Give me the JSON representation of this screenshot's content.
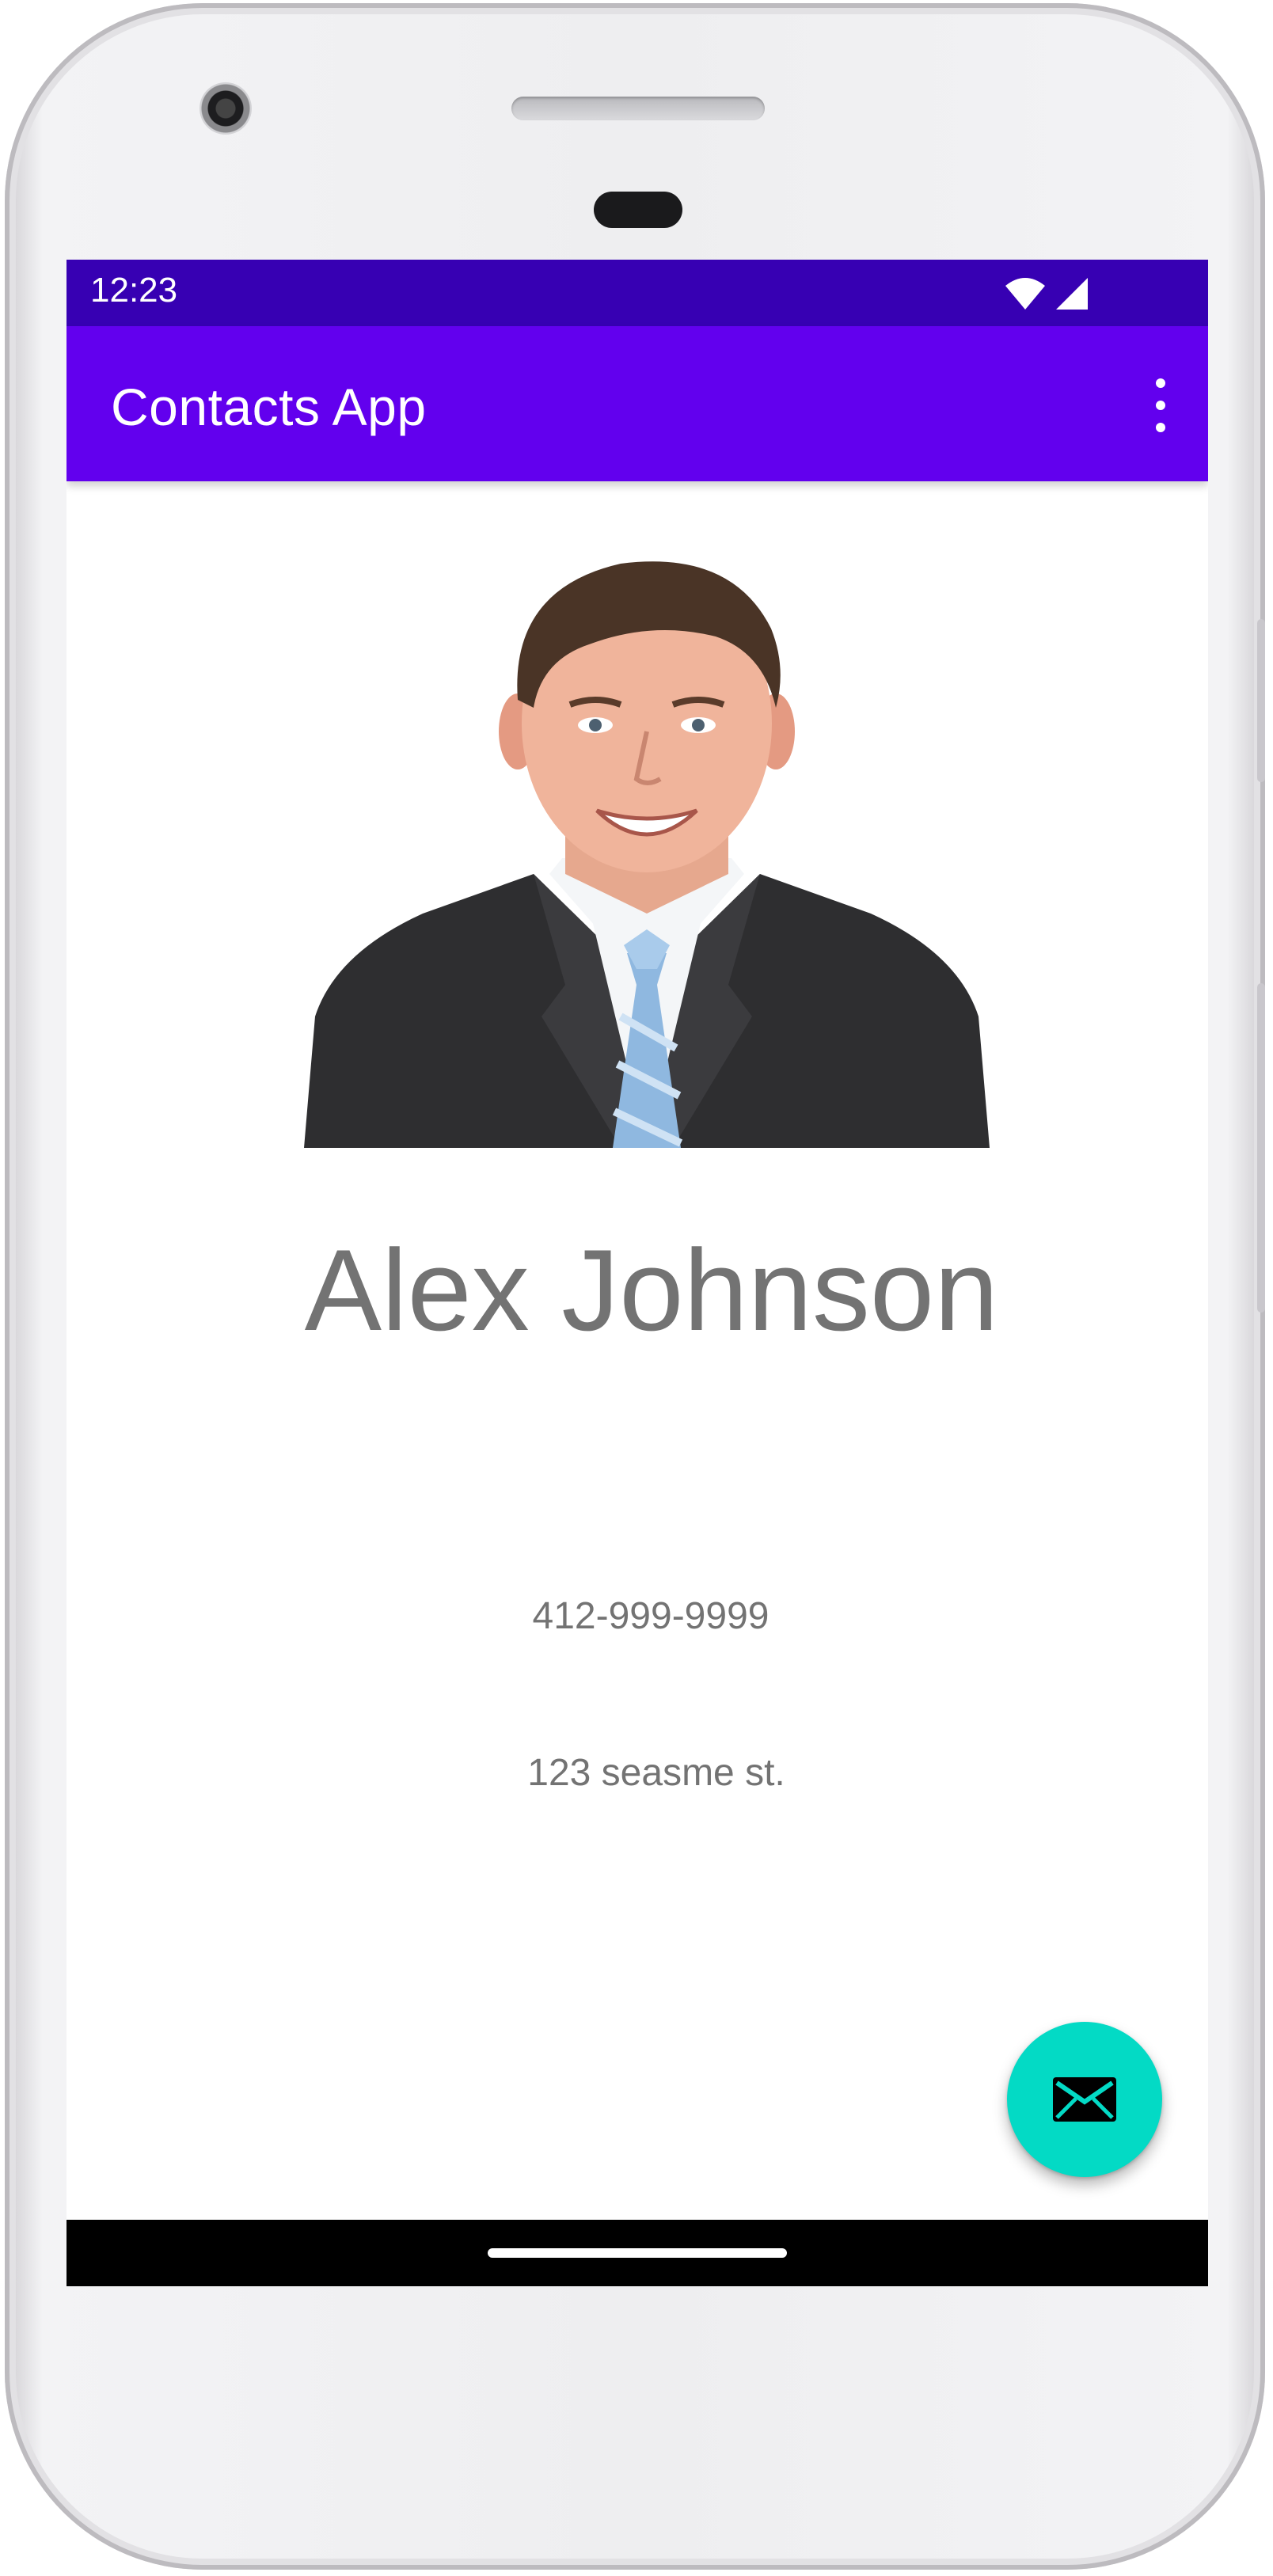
{
  "status_bar": {
    "time": "12:23",
    "icons": [
      "wifi-icon",
      "cellular-signal-icon"
    ],
    "color": "#3700b3"
  },
  "app_bar": {
    "title": "Contacts App",
    "color": "#6200ee",
    "overflow_icon": "more-vert-icon"
  },
  "contact": {
    "name": "Alex Johnson",
    "phone": "412-999-9999",
    "address": "123 seasme st.",
    "photo": "contact-photo"
  },
  "fab": {
    "icon": "email-icon",
    "color": "#03dac5"
  },
  "nav_bar": {
    "gesture": "home-pill"
  }
}
